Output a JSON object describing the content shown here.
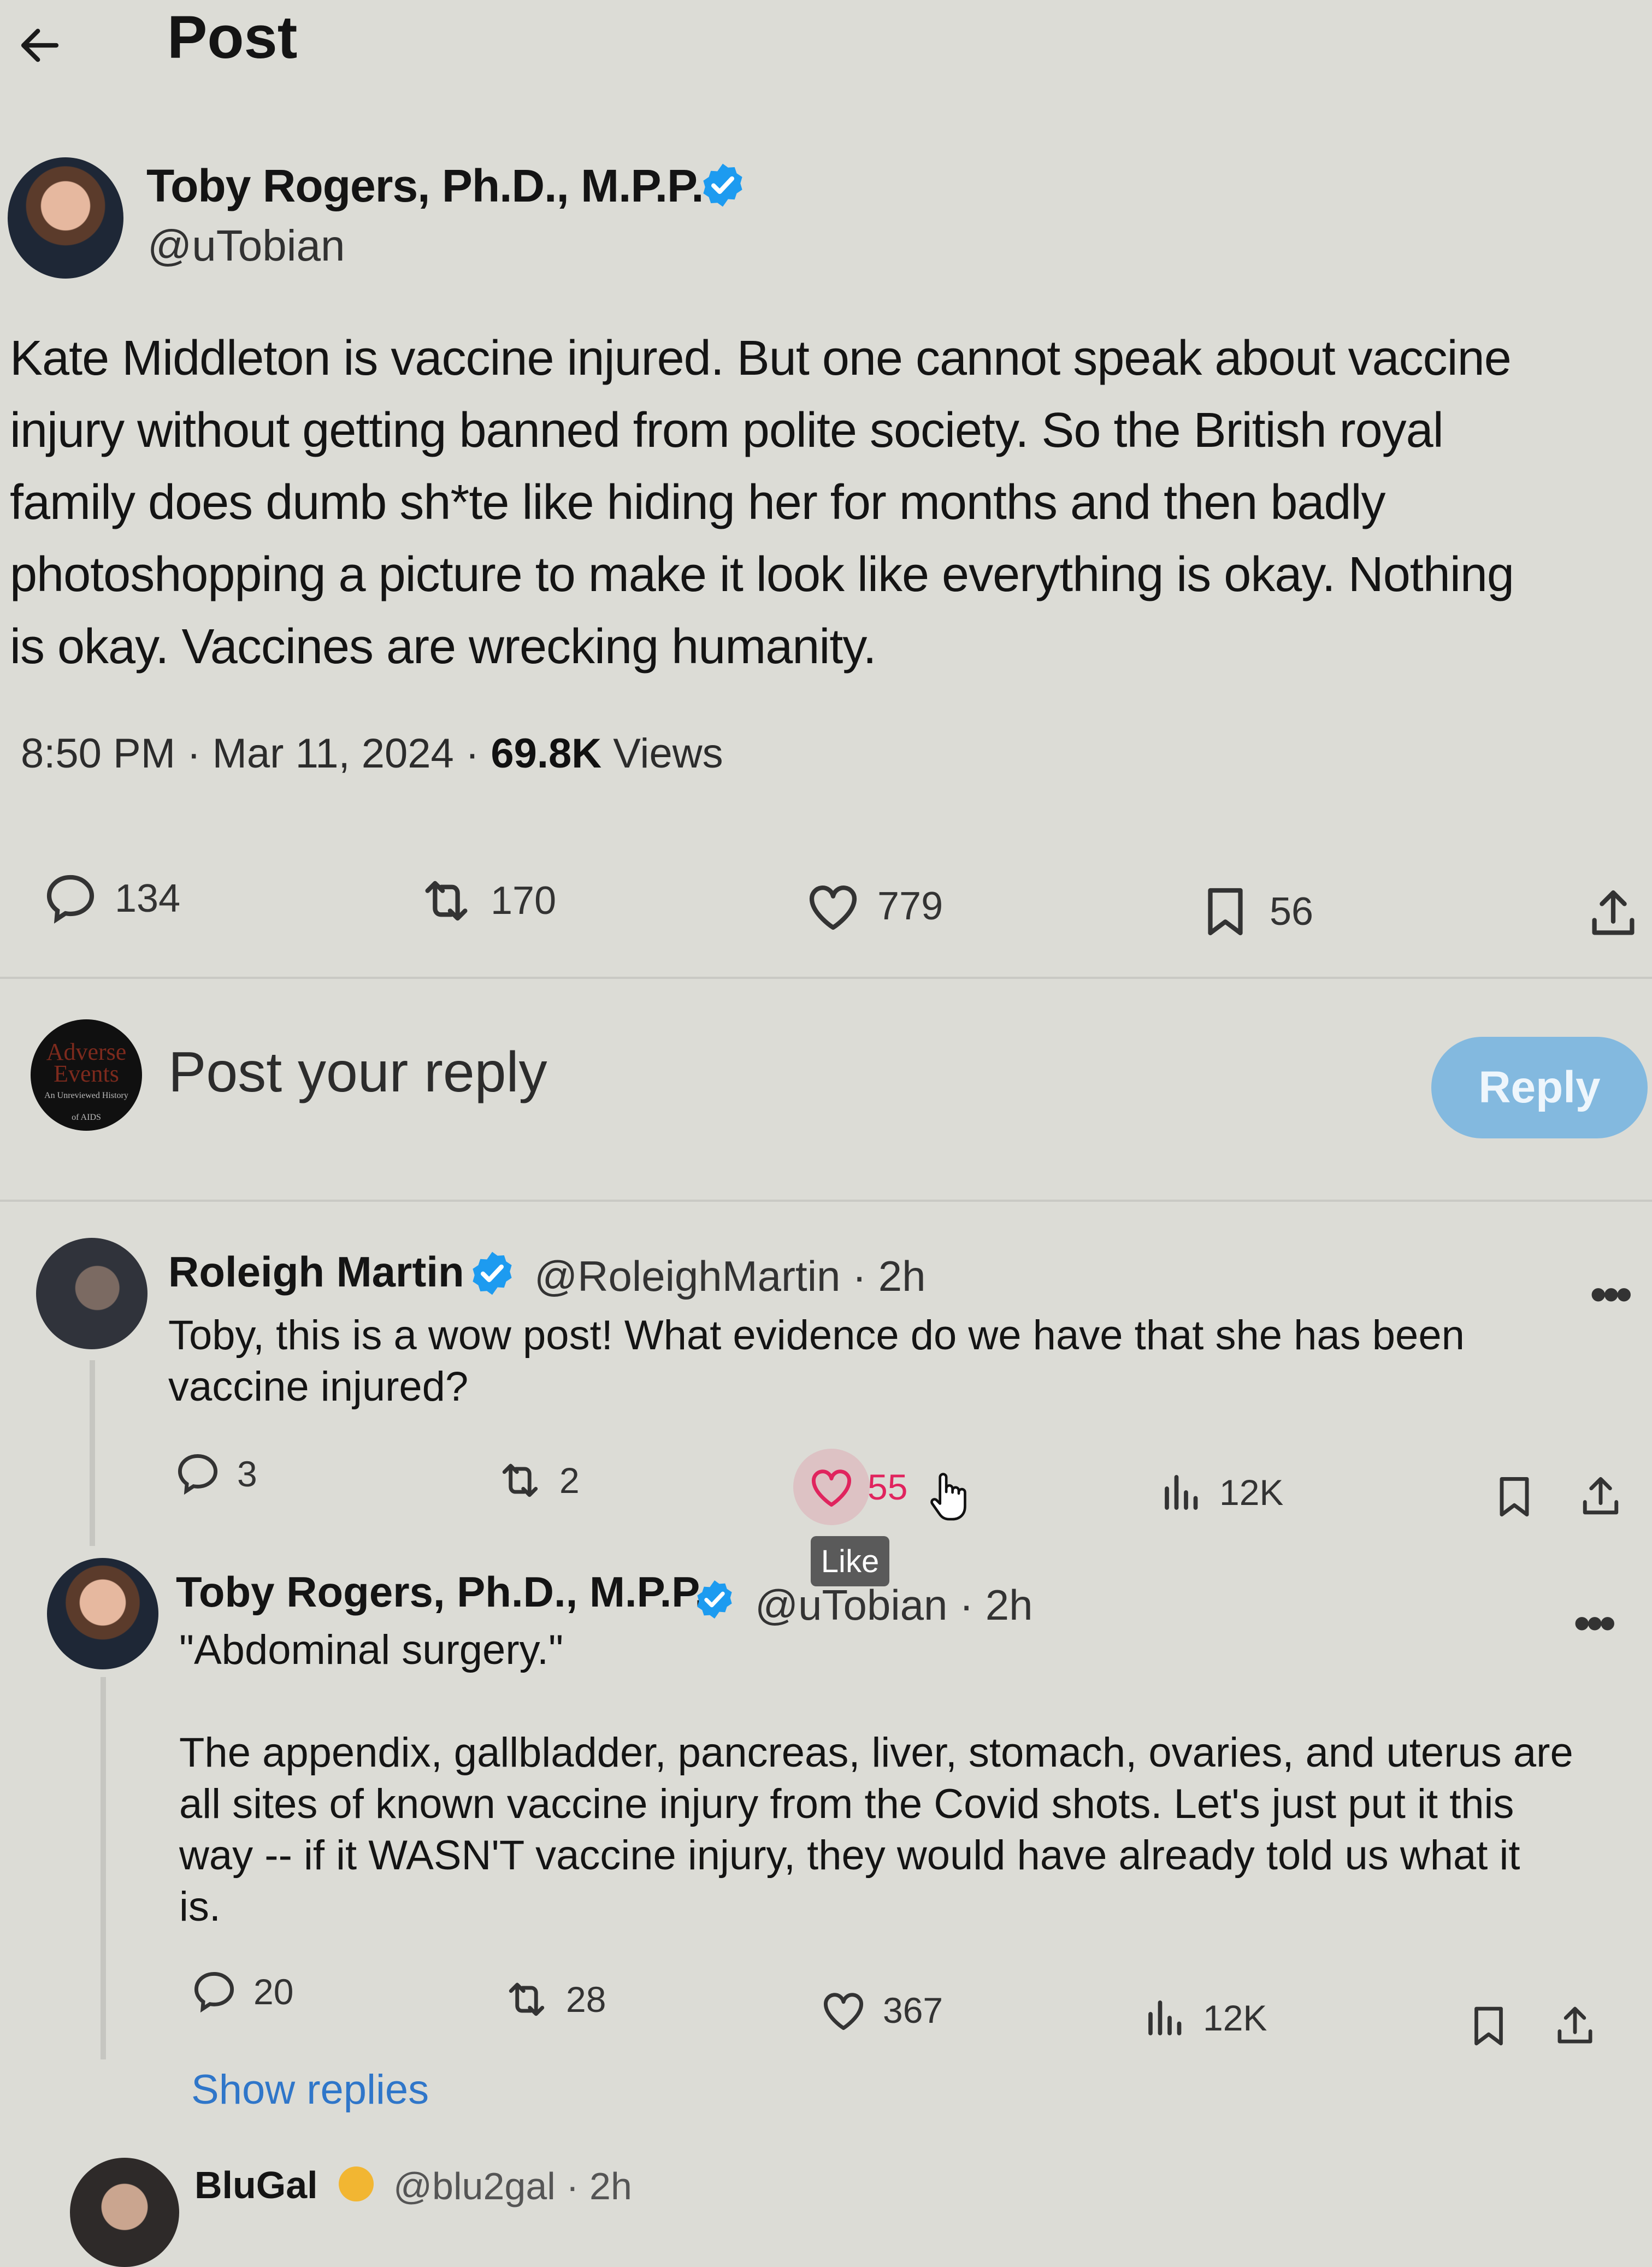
{
  "header": {
    "title": "Post"
  },
  "post": {
    "author_name": "Toby Rogers, Ph.D., M.P.P.",
    "author_handle": "@uTobian",
    "text_lines": [
      "Kate Middleton is vaccine injured. But one cannot speak about vaccine",
      "injury without getting banned from polite society. So the British royal",
      "family does dumb sh*te like hiding her for months and then badly",
      "photoshopping a picture to make it look like everything is okay. Nothing",
      "is okay. Vaccines are wrecking humanity."
    ],
    "timestamp": "8:50 PM · Mar 11, 2024 · ",
    "views_count": "69.8K",
    "views_label": " Views",
    "stats": {
      "replies": "134",
      "reposts": "170",
      "likes": "779",
      "bookmarks": "56"
    }
  },
  "reply_box": {
    "placeholder": "Post your reply",
    "button_label": "Reply",
    "avatar_text": [
      "Adverse",
      "Events",
      "An Unreviewed History",
      "of AIDS"
    ]
  },
  "replies": [
    {
      "author_name": "Roleigh Martin",
      "author_handle": "@RoleighMartin · 2h",
      "text_lines": [
        "Toby, this is a wow post!  What evidence do we have that she has been",
        "vaccine injured?"
      ],
      "stats": {
        "replies": "3",
        "reposts": "2",
        "likes": "55",
        "views": "12K"
      },
      "tooltip": "Like"
    },
    {
      "author_name": "Toby Rogers, Ph.D., M.P.P.",
      "author_handle": "@uTobian · 2h",
      "text_lines": [
        "\"Abdominal surgery.\"",
        "",
        "The appendix, gallbladder, pancreas, liver, stomach, ovaries, and uterus are",
        "all sites of known vaccine injury from the Covid shots. Let's just put it this",
        "way -- if it WASN'T vaccine injury, they would have already told us what it",
        "is."
      ],
      "stats": {
        "replies": "20",
        "reposts": "28",
        "likes": "367",
        "views": "12K"
      }
    }
  ],
  "show_replies": "Show replies",
  "next_reply": {
    "author_name": "BluGal",
    "author_handle": "@blu2gal · 2h"
  },
  "colors": {
    "accent": "#1d9bf0",
    "reply_button": "#83b9df",
    "like_active": "#e0245e"
  }
}
